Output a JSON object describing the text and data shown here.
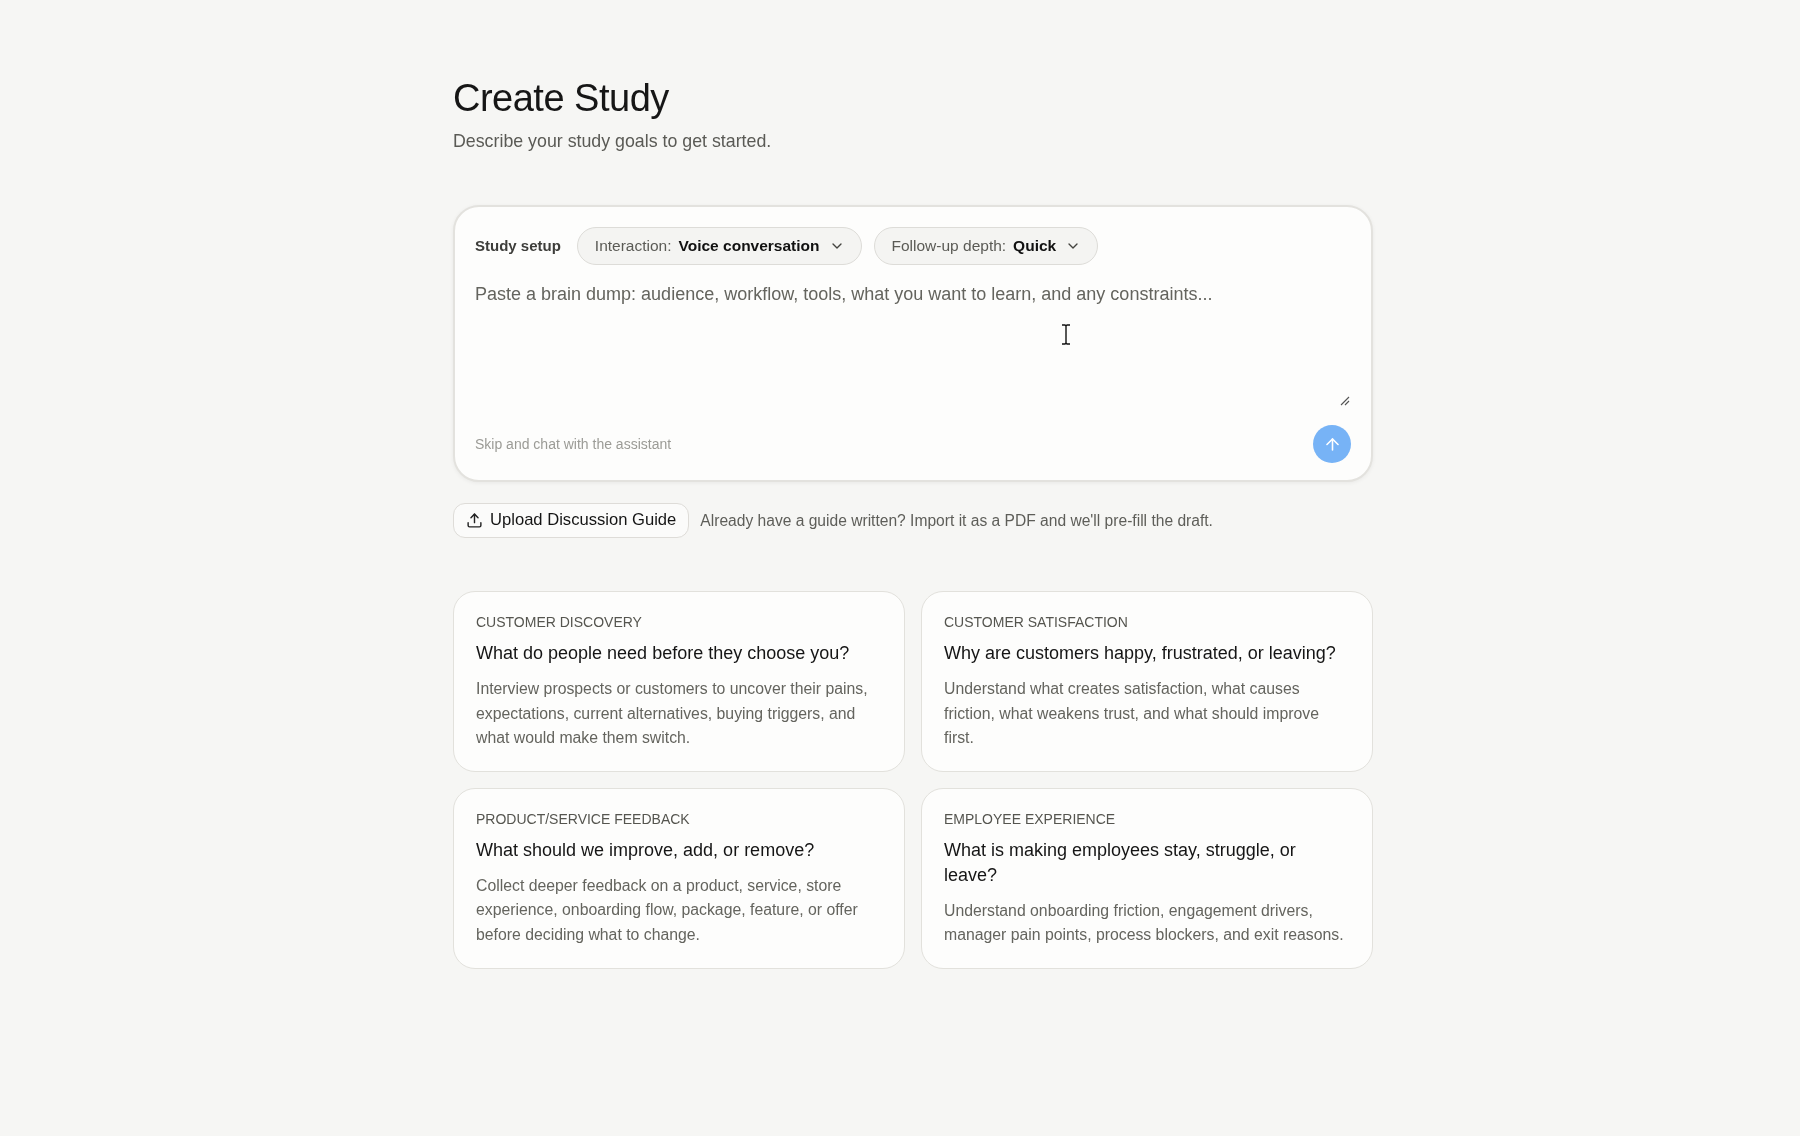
{
  "header": {
    "title": "Create Study",
    "subtitle": "Describe your study goals to get started."
  },
  "composer": {
    "setup_label": "Study setup",
    "selectors": [
      {
        "label": "Interaction:",
        "value": "Voice conversation"
      },
      {
        "label": "Follow-up depth:",
        "value": "Quick"
      }
    ],
    "prompt": {
      "placeholder": "Paste a brain dump: audience, workflow, tools, what you want to learn, and any constraints..."
    },
    "skip_link": "Skip and chat with the assistant",
    "send_button": {
      "disabled": true
    }
  },
  "upload": {
    "button": "Upload Discussion Guide",
    "hint": "Already have a guide written? Import it as a PDF and we'll pre-fill the draft."
  },
  "templates": [
    {
      "category": "CUSTOMER DISCOVERY",
      "question": "What do people need before they choose you?",
      "description": "Interview prospects or customers to uncover their pains, expectations, current alternatives, buying triggers, and what would make them switch."
    },
    {
      "category": "CUSTOMER SATISFACTION",
      "question": "Why are customers happy, frustrated, or leaving?",
      "description": "Understand what creates satisfaction, what causes friction, what weakens trust, and what should improve first."
    },
    {
      "category": "PRODUCT/SERVICE FEEDBACK",
      "question": "What should we improve, add, or remove?",
      "description": "Collect deeper feedback on a product, service, store experience, onboarding flow, package, feature, or offer before deciding what to change."
    },
    {
      "category": "EMPLOYEE EXPERIENCE",
      "question": "What is making employees stay, struggle, or leave?",
      "description": "Understand onboarding friction, engagement drivers, manager pain points, process blockers, and exit reasons."
    }
  ]
}
